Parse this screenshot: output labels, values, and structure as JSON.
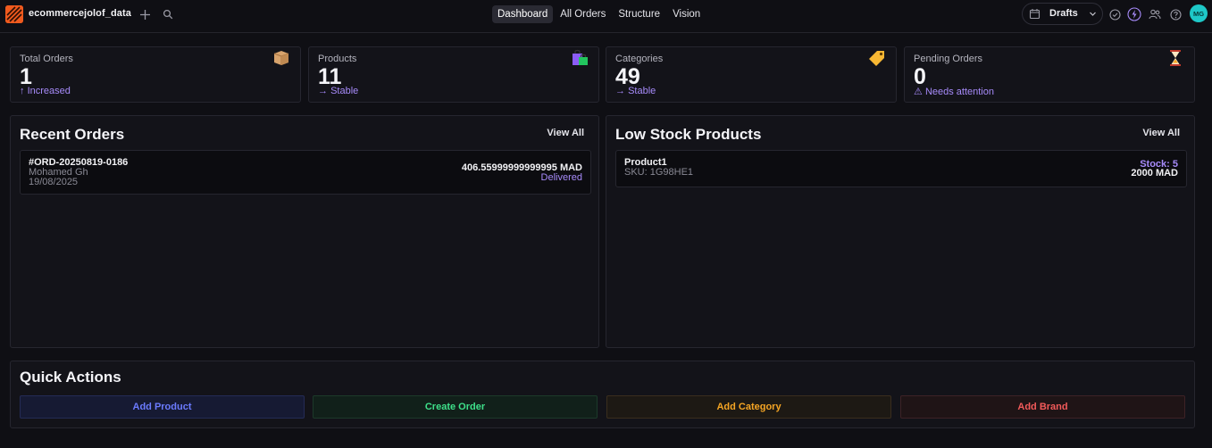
{
  "topbar": {
    "app_name": "ecommercejolof_data",
    "nav": [
      "Dashboard",
      "All Orders",
      "Structure",
      "Vision"
    ],
    "active_nav": "Dashboard",
    "drafts_label": "Drafts",
    "avatar_initials": "MG"
  },
  "stats": [
    {
      "label": "Total Orders",
      "value": "1",
      "trend": "Increased",
      "trend_icon": "↑",
      "icon": "package-icon"
    },
    {
      "label": "Products",
      "value": "11",
      "trend": "Stable",
      "trend_icon": "→",
      "icon": "shopping-bags-icon"
    },
    {
      "label": "Categories",
      "value": "49",
      "trend": "Stable",
      "trend_icon": "→",
      "icon": "tag-icon"
    },
    {
      "label": "Pending Orders",
      "value": "0",
      "trend": "Needs attention",
      "trend_icon": "⚠",
      "icon": "hourglass-icon"
    }
  ],
  "recent_orders": {
    "title": "Recent Orders",
    "view_all": "View All",
    "items": [
      {
        "id": "#ORD-20250819-0186",
        "customer": "Mohamed Gh",
        "date": "19/08/2025",
        "amount": "406.55999999999995 MAD",
        "status": "Delivered"
      }
    ]
  },
  "low_stock": {
    "title": "Low Stock Products",
    "view_all": "View All",
    "items": [
      {
        "name": "Product1",
        "sku": "SKU: 1G98HE1",
        "stock": "Stock: 5",
        "price": "2000 MAD"
      }
    ]
  },
  "quick_actions": {
    "title": "Quick Actions",
    "buttons": [
      {
        "label": "Add Product",
        "color": "#6b7bff"
      },
      {
        "label": "Create Order",
        "color": "#3ee08a"
      },
      {
        "label": "Add Category",
        "color": "#f5a524"
      },
      {
        "label": "Add Brand",
        "color": "#f25a5a"
      }
    ]
  },
  "colors": {
    "background": "#0f0f14",
    "card": "#131319",
    "accent": "#a78bfa",
    "brand": "#ef5a1e",
    "avatar": "#1ec8c8"
  }
}
